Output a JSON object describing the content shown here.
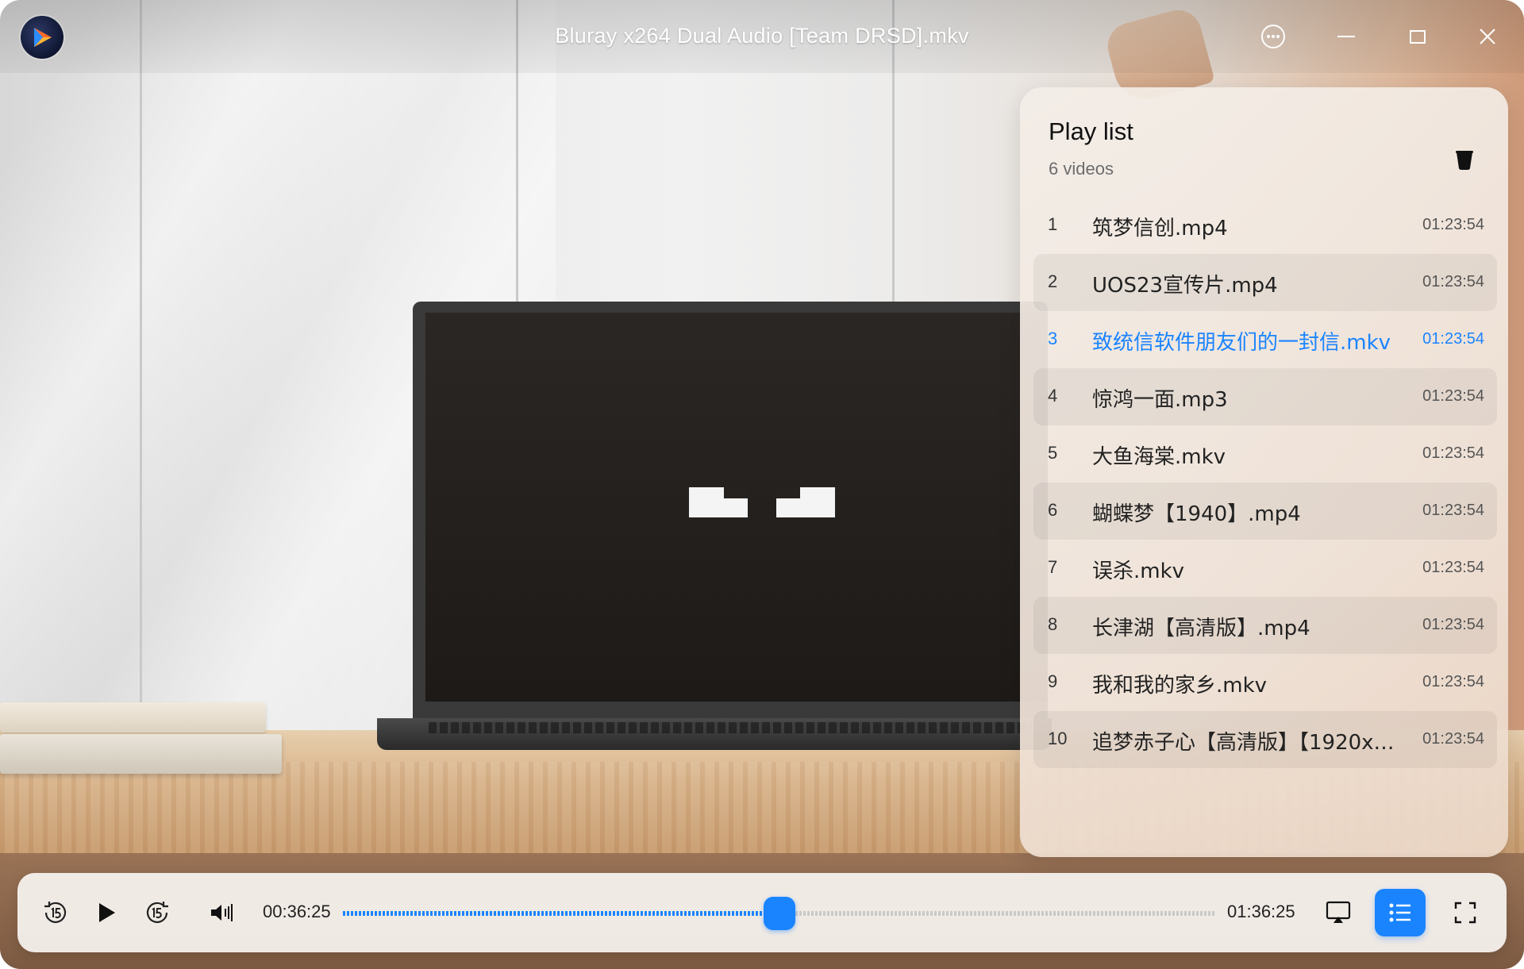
{
  "window": {
    "title": "Bluray x264 Dual Audio [Team DRSD].mkv",
    "app_icon": "deepin-movie-icon",
    "buttons": [
      "more-icon",
      "minimize-icon",
      "maximize-icon",
      "close-icon"
    ]
  },
  "playlist": {
    "title": "Play list",
    "count": "6 videos",
    "clear_icon": "trash-icon",
    "active_index": 2,
    "items": [
      {
        "num": "1",
        "name": "筑梦信创.mp4",
        "duration": "01:23:54"
      },
      {
        "num": "2",
        "name": "UOS23宣传片.mp4",
        "duration": "01:23:54"
      },
      {
        "num": "3",
        "name": "致统信软件朋友们的一封信.mkv",
        "duration": "01:23:54"
      },
      {
        "num": "4",
        "name": "惊鸿一面.mp3",
        "duration": "01:23:54"
      },
      {
        "num": "5",
        "name": "大鱼海棠.mkv",
        "duration": "01:23:54"
      },
      {
        "num": "6",
        "name": "蝴蝶梦【1940】.mp4",
        "duration": "01:23:54"
      },
      {
        "num": "7",
        "name": "误杀.mkv",
        "duration": "01:23:54"
      },
      {
        "num": "8",
        "name": "长津湖【高清版】.mp4",
        "duration": "01:23:54"
      },
      {
        "num": "9",
        "name": "我和我的家乡.mkv",
        "duration": "01:23:54"
      },
      {
        "num": "10",
        "name": "追梦赤子心【高清版】【1920x…",
        "duration": "01:23:54"
      }
    ]
  },
  "player": {
    "current_time": "00:36:25",
    "total_time": "01:36:25",
    "progress_fraction": 0.5,
    "accent_color": "#1a84ff",
    "icons": {
      "rewind": "rewind-15-icon",
      "play": "play-icon",
      "forward": "forward-15-icon",
      "volume": "volume-icon",
      "cast": "screen-cast-icon",
      "playlist": "playlist-icon",
      "fullscreen": "fullscreen-icon"
    }
  }
}
